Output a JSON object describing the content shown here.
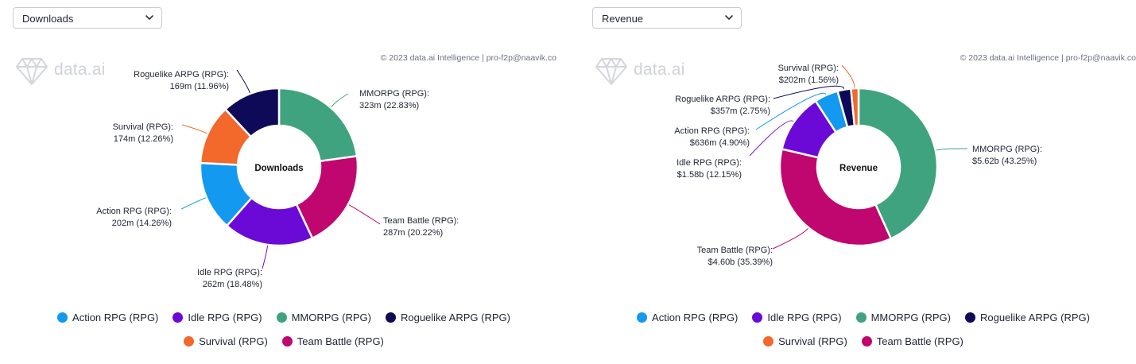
{
  "colors": {
    "Action RPG (RPG)": "#1399f0",
    "Idle RPG (RPG)": "#6b0ad6",
    "MMORPG (RPG)": "#40a37f",
    "Roguelike ARPG (RPG)": "#0e0a57",
    "Survival (RPG)": "#f2692b",
    "Team Battle (RPG)": "#c0066f"
  },
  "legend_order": [
    [
      "Action RPG (RPG)",
      "Idle RPG (RPG)",
      "MMORPG (RPG)",
      "Roguelike ARPG (RPG)"
    ],
    [
      "Survival (RPG)",
      "Team Battle (RPG)"
    ]
  ],
  "panels": [
    {
      "dropdown_value": "Downloads",
      "dropdown_icon": "chevron-down-icon",
      "logo_icon": "diamond-icon",
      "logo_text": "data.ai",
      "copyright": "© 2023 data.ai Intelligence | pro-f2p@naavik.co"
    },
    {
      "dropdown_value": "Revenue",
      "dropdown_icon": "chevron-down-icon",
      "logo_icon": "diamond-icon",
      "logo_text": "data.ai",
      "copyright": "© 2023 data.ai Intelligence | pro-f2p@naavik.co"
    }
  ],
  "chart_data": [
    {
      "type": "pie",
      "variant": "donut",
      "center_label": "Downloads",
      "slices": [
        {
          "name": "MMORPG (RPG)",
          "value": 323,
          "value_label": "323m",
          "percent_label": "22.83%"
        },
        {
          "name": "Team Battle (RPG)",
          "value": 287,
          "value_label": "287m",
          "percent_label": "20.22%"
        },
        {
          "name": "Idle RPG (RPG)",
          "value": 262,
          "value_label": "262m",
          "percent_label": "18.48%"
        },
        {
          "name": "Action RPG (RPG)",
          "value": 202,
          "value_label": "202m",
          "percent_label": "14.26%"
        },
        {
          "name": "Survival (RPG)",
          "value": 174,
          "value_label": "174m",
          "percent_label": "12.26%"
        },
        {
          "name": "Roguelike ARPG (RPG)",
          "value": 169,
          "value_label": "169m",
          "percent_label": "11.96%"
        }
      ],
      "legend_position": "bottom"
    },
    {
      "type": "pie",
      "variant": "donut",
      "center_label": "Revenue",
      "slices": [
        {
          "name": "MMORPG (RPG)",
          "value": 5.62,
          "value_label": "$5.62b",
          "percent_label": "43.25%"
        },
        {
          "name": "Team Battle (RPG)",
          "value": 4.6,
          "value_label": "$4.60b",
          "percent_label": "35.39%"
        },
        {
          "name": "Idle RPG (RPG)",
          "value": 1.58,
          "value_label": "$1.58b",
          "percent_label": "12.15%"
        },
        {
          "name": "Action RPG (RPG)",
          "value": 0.636,
          "value_label": "$636m",
          "percent_label": "4.90%"
        },
        {
          "name": "Roguelike ARPG (RPG)",
          "value": 0.357,
          "value_label": "$357m",
          "percent_label": "2.75%"
        },
        {
          "name": "Survival (RPG)",
          "value": 0.202,
          "value_label": "$202m",
          "percent_label": "1.56%"
        }
      ],
      "legend_position": "bottom"
    }
  ]
}
